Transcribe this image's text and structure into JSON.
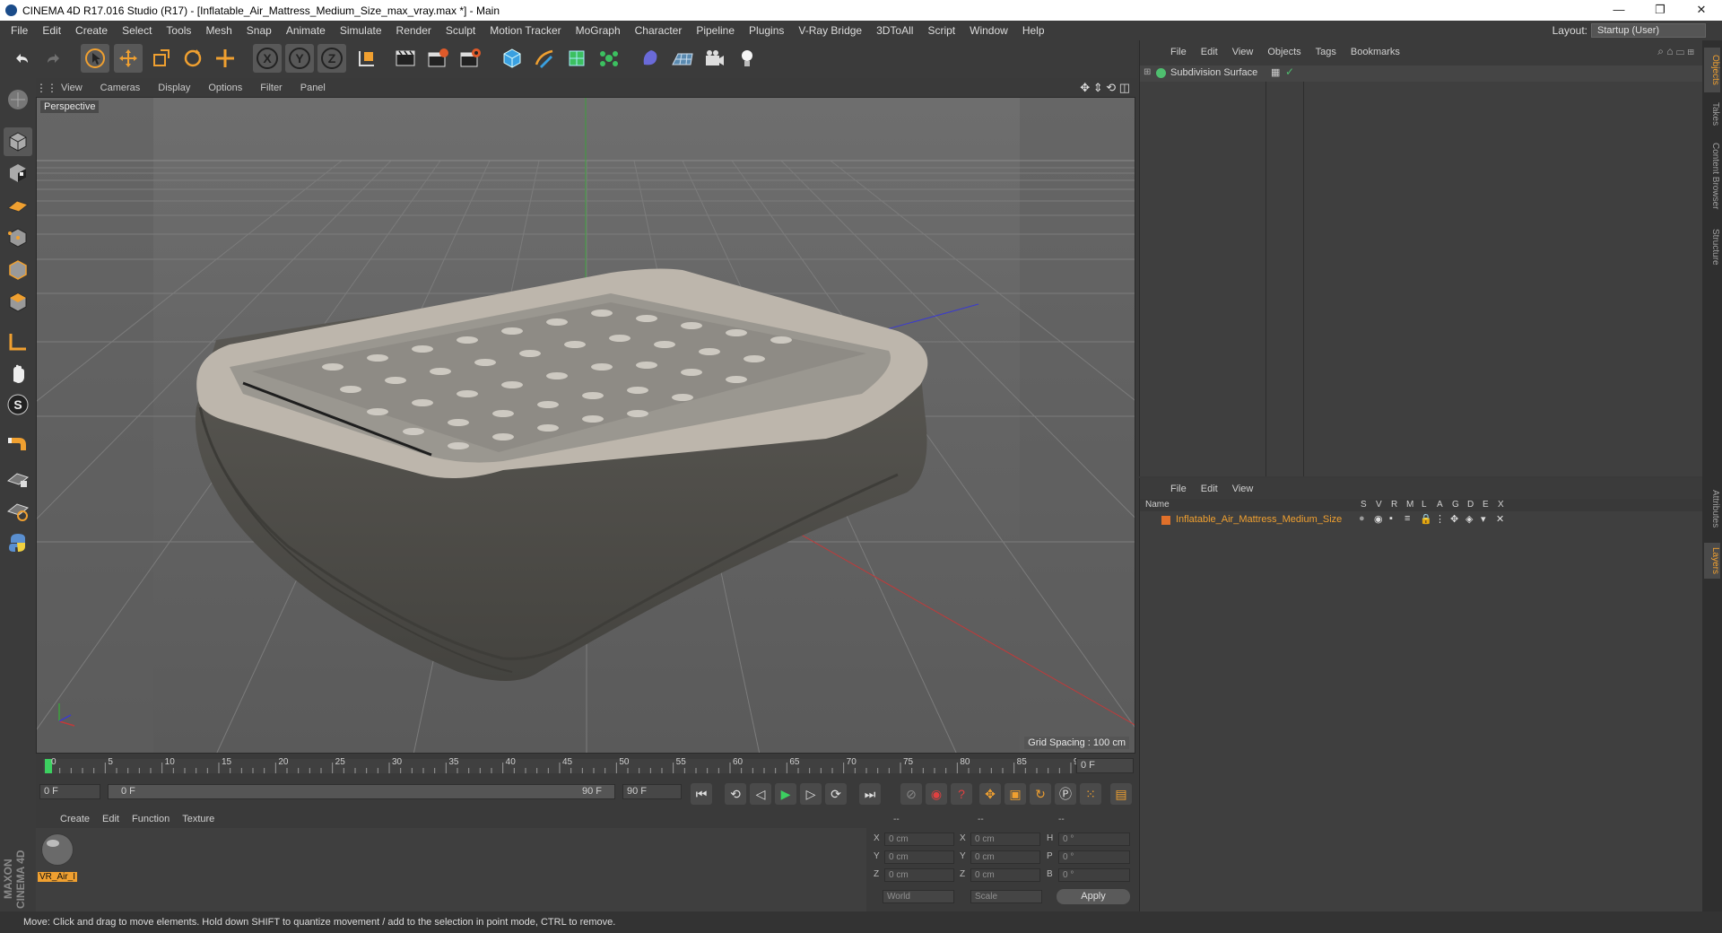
{
  "window": {
    "title": "CINEMA 4D R17.016 Studio (R17) - [Inflatable_Air_Mattress_Medium_Size_max_vray.max *] - Main",
    "minimize": "—",
    "restore": "❐",
    "close": "✕"
  },
  "menubar": {
    "items": [
      "File",
      "Edit",
      "Create",
      "Select",
      "Tools",
      "Mesh",
      "Snap",
      "Animate",
      "Simulate",
      "Render",
      "Sculpt",
      "Motion Tracker",
      "MoGraph",
      "Character",
      "Pipeline",
      "Plugins",
      "V-Ray Bridge",
      "3DToAll",
      "Script",
      "Window",
      "Help"
    ],
    "layout_label": "Layout:",
    "layout_value": "Startup (User)"
  },
  "toolbar": {
    "icons": [
      "undo-icon",
      "redo-icon",
      "select-arrow-icon",
      "move-icon",
      "scale-icon",
      "rotate-icon",
      "add-icon",
      "x-axis-icon",
      "y-axis-icon",
      "z-axis-icon",
      "coordinate-system-icon",
      "render-view-icon",
      "render-picture-viewer-icon",
      "render-settings-icon",
      "cube-icon",
      "pen-icon",
      "subdivision-icon",
      "cloner-icon",
      "deformer-icon",
      "floor-icon",
      "camera-icon",
      "light-icon"
    ],
    "axis_labels": [
      "X",
      "Y",
      "Z"
    ]
  },
  "viewport": {
    "menu": [
      "View",
      "Cameras",
      "Display",
      "Options",
      "Filter",
      "Panel"
    ],
    "label": "Perspective",
    "grid_spacing": "Grid Spacing : 100 cm"
  },
  "timeline": {
    "ticks": [
      "0",
      "5",
      "10",
      "15",
      "20",
      "25",
      "30",
      "35",
      "40",
      "45",
      "50",
      "55",
      "60",
      "65",
      "70",
      "75",
      "80",
      "85",
      "90"
    ],
    "current_frame": "0 F",
    "start_field": "0 F",
    "range_start": "0 F",
    "range_end": "90 F",
    "end_field": "90 F"
  },
  "material_panel": {
    "menu": [
      "Create",
      "Edit",
      "Function",
      "Texture"
    ],
    "materials": [
      {
        "name": "VR_Air_I"
      }
    ]
  },
  "coordinates": {
    "header": [
      "--",
      "--",
      "--"
    ],
    "rows": [
      {
        "a": "X",
        "av": "0 cm",
        "b": "X",
        "bv": "0 cm",
        "c": "H",
        "cv": "0 °"
      },
      {
        "a": "Y",
        "av": "0 cm",
        "b": "Y",
        "bv": "0 cm",
        "c": "P",
        "cv": "0 °"
      },
      {
        "a": "Z",
        "av": "0 cm",
        "b": "Z",
        "bv": "0 cm",
        "c": "B",
        "cv": "0 °"
      }
    ],
    "space": "World",
    "mode": "Scale",
    "apply": "Apply"
  },
  "objects_panel": {
    "menu": [
      "File",
      "Edit",
      "View",
      "Objects",
      "Tags",
      "Bookmarks"
    ],
    "items": [
      {
        "name": "Subdivision Surface"
      }
    ]
  },
  "layers_panel": {
    "menu": [
      "File",
      "Edit",
      "View"
    ],
    "name_header": "Name",
    "columns": [
      "S",
      "V",
      "R",
      "M",
      "L",
      "A",
      "G",
      "D",
      "E",
      "X"
    ],
    "items": [
      {
        "name": "Inflatable_Air_Mattress_Medium_Size"
      }
    ]
  },
  "side_tabs": [
    "Objects",
    "Takes",
    "Content Browser",
    "Structure",
    "Attributes",
    "Layers"
  ],
  "brand": "MAXON CINEMA 4D",
  "status": "Move: Click and drag to move elements. Hold down SHIFT to quantize movement / add to the selection in point mode, CTRL to remove.",
  "colors": {
    "accent": "#f0a030",
    "layer_color": "#e0702a",
    "object_green": "#4fbf6f"
  }
}
